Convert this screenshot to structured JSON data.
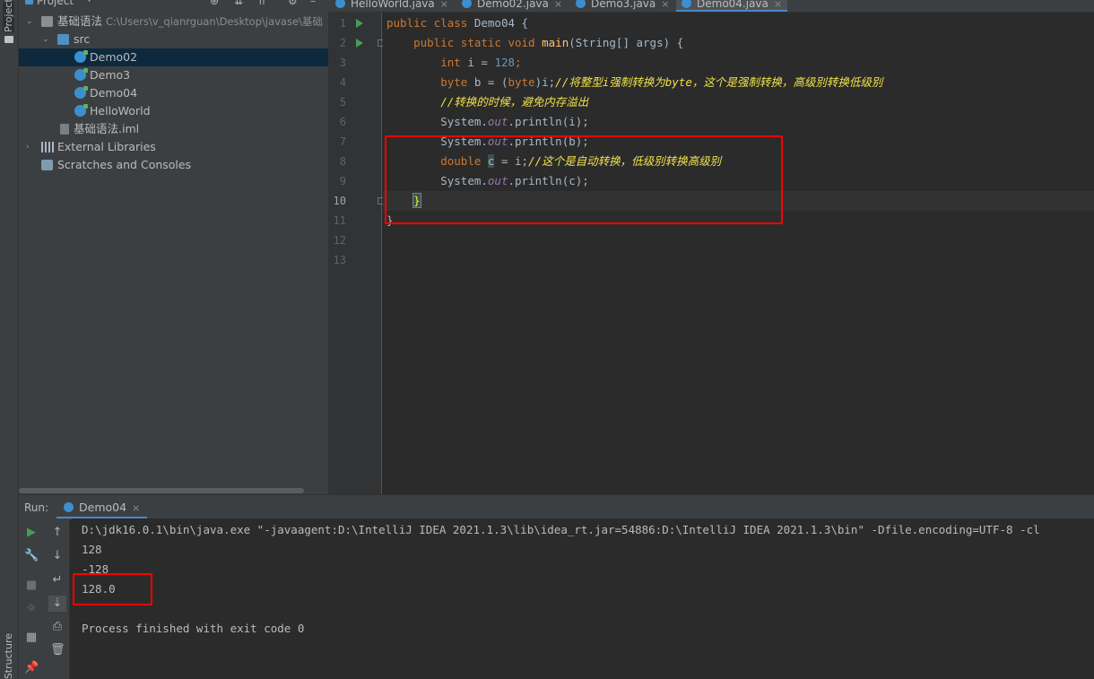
{
  "sidebar_left": {
    "project_label": "Project",
    "structure_label": "Structure"
  },
  "project_panel": {
    "title": "Project",
    "tree": [
      {
        "label": "基础语法",
        "path": "C:\\Users\\v_qianrguan\\Desktop\\javase\\基础"
      },
      {
        "label": "src"
      },
      {
        "label": "Demo02"
      },
      {
        "label": "Demo3"
      },
      {
        "label": "Demo04"
      },
      {
        "label": "HelloWorld"
      },
      {
        "label": "基础语法.iml"
      },
      {
        "label": "External Libraries"
      },
      {
        "label": "Scratches and Consoles"
      }
    ]
  },
  "tabs": [
    {
      "label": "HelloWorld.java"
    },
    {
      "label": "Demo02.java"
    },
    {
      "label": "Demo3.java"
    },
    {
      "label": "Demo04.java"
    }
  ],
  "editor": {
    "line_numbers": [
      "1",
      "2",
      "3",
      "4",
      "5",
      "6",
      "7",
      "8",
      "9",
      "10",
      "11",
      "12",
      "13"
    ],
    "code": {
      "l1_kw1": "public",
      "l1_kw2": "class",
      "l1_name": "Demo04 {",
      "l2_kw1": "public",
      "l2_kw2": "static",
      "l2_kw3": "void",
      "l2_fn": "main",
      "l2_rest": "(String[] args) {",
      "l3_kw": "int",
      "l3_mid": " i = ",
      "l3_num": "128",
      "l3_end": ";",
      "l4_kw": "byte",
      "l4_mid": " b = (",
      "l4_kw2": "byte",
      "l4_end": ")i;",
      "l4_cm": "//将整型i强制转换为byte，这个是强制转换，高级别转换低级别",
      "l5_cm": "//转换的时候，避免内存溢出",
      "l6_a": "System.",
      "l6_field": "out",
      "l6_b": ".println(i);",
      "l7_a": "System.",
      "l7_field": "out",
      "l7_b": ".println(b);",
      "l8_kw": "double",
      "l8_var": "c",
      "l8_mid": " = i;",
      "l8_cm": "//这个是自动转换，低级别转换高级别",
      "l9_a": "System.",
      "l9_field": "out",
      "l9_b": ".println(c);",
      "l10": "}",
      "l11": "}"
    }
  },
  "run_panel": {
    "run_label": "Run:",
    "tab_label": "Demo04",
    "output": [
      "D:\\jdk16.0.1\\bin\\java.exe \"-javaagent:D:\\IntelliJ IDEA 2021.1.3\\lib\\idea_rt.jar=54886:D:\\IntelliJ IDEA 2021.1.3\\bin\" -Dfile.encoding=UTF-8 -cl",
      "128",
      "-128",
      "128.0",
      "",
      "Process finished with exit code 0"
    ]
  },
  "colors": {
    "background": "#2b2b2b",
    "panel": "#3c3f41",
    "keyword": "#cc7832",
    "method": "#ffc66d",
    "number": "#6897bb",
    "field": "#9876aa",
    "comment": "#f0e14a",
    "annotation_box": "#ff0000",
    "selection": "#0d293e"
  }
}
